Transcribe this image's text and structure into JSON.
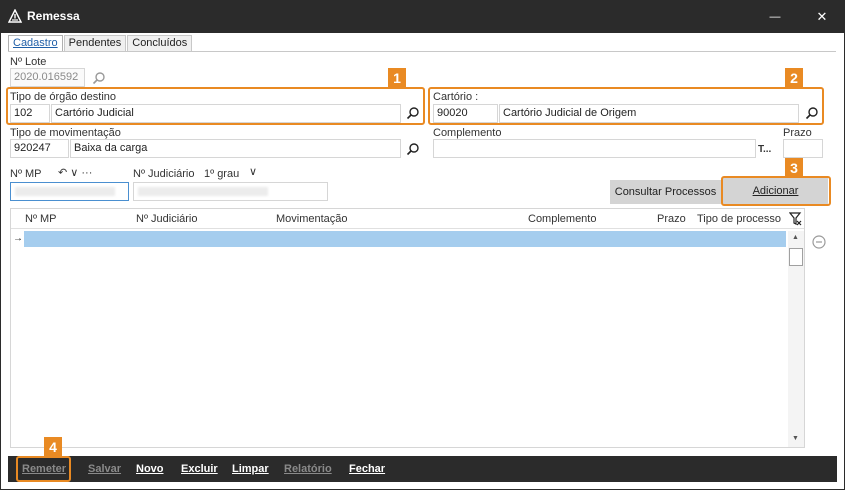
{
  "window": {
    "title": "Remessa",
    "minimize_glyph": "—",
    "close_glyph": "✕"
  },
  "tabs": [
    {
      "label": "Cadastro",
      "active": true
    },
    {
      "label": "Pendentes",
      "active": false
    },
    {
      "label": "Concluídos",
      "active": false
    }
  ],
  "form": {
    "lote_label": "Nº Lote",
    "lote_value": "2020.016592",
    "tipo_orgao_label": "Tipo de órgão destino",
    "tipo_orgao_code": "102",
    "tipo_orgao_name": "Cartório Judicial",
    "cartorio_label": "Cartório :",
    "cartorio_code": "90020",
    "cartorio_name": "Cartório Judicial de Origem",
    "tipo_mov_label": "Tipo de movimentação",
    "tipo_mov_code": "920247",
    "tipo_mov_name": "Baixa da carga",
    "complemento_label": "Complemento",
    "complemento_value": "",
    "complemento_suffix": "T...",
    "prazo_label": "Prazo",
    "prazo_value": "",
    "mp_label": "Nº MP",
    "mp_tools": "↶ ∨ ···",
    "judiciario_label": "Nº Judiciário",
    "grau_label": "1º grau",
    "grau_chevron": "∨"
  },
  "buttons": {
    "consultar": "Consultar Processos",
    "adicionar": "Adicionar"
  },
  "grid": {
    "columns": [
      "Nº MP",
      "Nº Judiciário",
      "Movimentação",
      "Complemento",
      "Prazo",
      "Tipo de processo"
    ],
    "row_marker": "→",
    "scroll_up": "▲",
    "scroll_down": "▼"
  },
  "footer": {
    "remeter": "Remeter",
    "salvar": "Salvar",
    "novo": "Novo",
    "excluir": "Excluir",
    "limpar": "Limpar",
    "relatorio": "Relatório",
    "fechar": "Fechar"
  },
  "callouts": [
    "1",
    "2",
    "3",
    "4"
  ],
  "icons": {
    "app": "warning-triangle-icon",
    "search": "magnifier-icon",
    "filter": "filter-icon",
    "minus": "minus-circle-icon"
  },
  "colors": {
    "titlebar": "#2b2b2b",
    "accent_callout": "#e98a23",
    "selection": "#a5cdee",
    "tab_active_text": "#1f5fa8"
  }
}
